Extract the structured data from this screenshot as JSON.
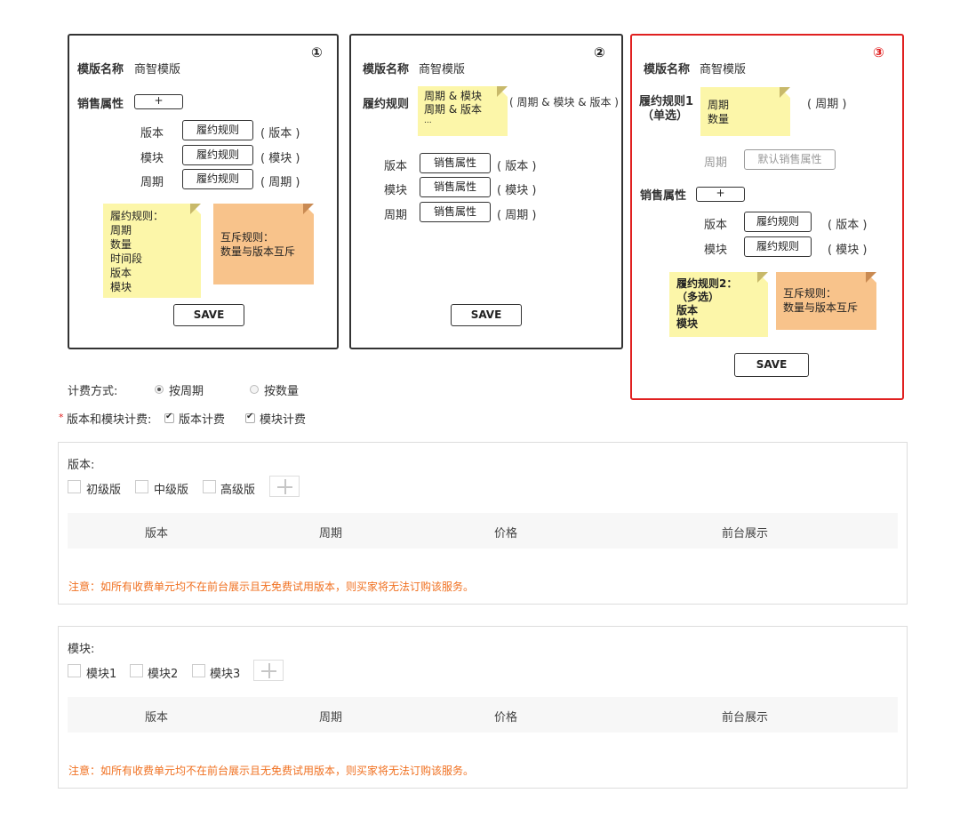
{
  "panel1": {
    "number": "①",
    "template_label": "模版名称",
    "template_value": "商智模版",
    "sales_attr_label": "销售属性",
    "plus": "+",
    "rows": [
      {
        "name": "版本",
        "button": "履约规则",
        "tag": "( 版本 )"
      },
      {
        "name": "模块",
        "button": "履约规则",
        "tag": "( 模块 )"
      },
      {
        "name": "周期",
        "button": "履约规则",
        "tag": "( 周期 )"
      }
    ],
    "note_yellow": [
      "履约规则：",
      "周期",
      "数量",
      "时间段",
      "版本",
      "模块"
    ],
    "note_orange": [
      "互斥规则：",
      "数量与版本互斥"
    ],
    "save": "SAVE"
  },
  "panel2": {
    "number": "②",
    "template_label": "模版名称",
    "template_value": "商智模版",
    "rule_label": "履约规则",
    "note_yellow": [
      "周期 & 模块",
      "周期 & 版本",
      "..."
    ],
    "rule_tag": "( 周期 & 模块 & 版本 )",
    "rows": [
      {
        "name": "版本",
        "button": "销售属性",
        "tag": "( 版本 )"
      },
      {
        "name": "模块",
        "button": "销售属性",
        "tag": "( 模块 )"
      },
      {
        "name": "周期",
        "button": "销售属性",
        "tag": "( 周期 )"
      }
    ],
    "save": "SAVE"
  },
  "panel3": {
    "number": "③",
    "template_label": "模版名称",
    "template_value": "商智模版",
    "rule1_label_1": "履约规则1",
    "rule1_label_2": "（单选）",
    "note_rule1": [
      "周期",
      "数量"
    ],
    "rule1_tag": "( 周期 )",
    "period_label": "周期",
    "period_button": "默认销售属性",
    "sales_attr_label": "销售属性",
    "plus": "+",
    "rows": [
      {
        "name": "版本",
        "button": "履约规则",
        "tag": "( 版本 )"
      },
      {
        "name": "模块",
        "button": "履约规则",
        "tag": "( 模块 )"
      }
    ],
    "note_rule2": [
      "履约规则2：",
      "（多选）",
      "版本",
      "模块"
    ],
    "note_orange": [
      "互斥规则：",
      "数量与版本互斥"
    ],
    "save": "SAVE"
  },
  "billing": {
    "label": "计费方式:",
    "option1": "按周期",
    "option2": "按数量",
    "selected": "按周期"
  },
  "version_module_billing": {
    "required_mark": "*",
    "label": "版本和模块计费:",
    "check1": "版本计费",
    "check2": "模块计费"
  },
  "version_section": {
    "title": "版本:",
    "options": [
      "初级版",
      "中级版",
      "高级版"
    ],
    "columns": [
      "版本",
      "周期",
      "价格",
      "前台展示"
    ],
    "notice": "注意：如所有收费单元均不在前台展示且无免费试用版本，则买家将无法订购该服务。"
  },
  "module_section": {
    "title": "模块:",
    "options": [
      "模块1",
      "模块2",
      "模块3"
    ],
    "columns": [
      "版本",
      "周期",
      "价格",
      "前台展示"
    ],
    "notice": "注意：如所有收费单元均不在前台展示且无免费试用版本，则买家将无法订购该服务。"
  },
  "colors": {
    "accent_red": "#e02020",
    "note_yellow": "#fcf6a9",
    "note_orange": "#f8c38b",
    "warning_orange": "#f07020"
  }
}
